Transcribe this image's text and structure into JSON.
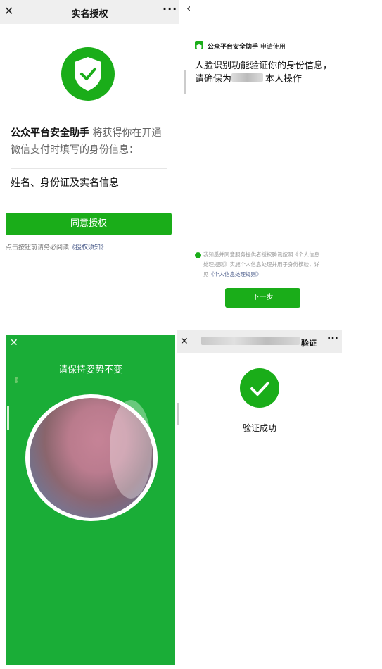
{
  "panel1": {
    "close": "✕",
    "title": "实名授权",
    "more": "···",
    "app_name": "公众平台安全助手",
    "will_get": " 将获得你在开通",
    "will_get_2": "微信支付时填写的身份信息：",
    "info": "姓名、身份证及实名信息",
    "agree_button": "同意授权",
    "notice_prefix": "点击按钮前请务必阅读",
    "notice_link": "《授权须知》"
  },
  "panel2": {
    "back": "‹",
    "app_name": "公众平台安全助手",
    "request": " 申请使用",
    "heading_line1": "人脸识别功能验证你的身份信息，",
    "heading_line2_prefix": "请确保为",
    "heading_line2_suffix": "本人操作",
    "terms_line1": "我知悉并同意服务提供者授权腾讯按照《个人信息",
    "terms_line2": "处理规则》实施个人信息处理并用于身份核验，详",
    "terms_line3_prefix": "见",
    "terms_line3_link": "《个人信息处理规则》",
    "next_button": "下一步"
  },
  "panel3": {
    "close": "✕",
    "hint": "请保持姿势不变"
  },
  "panel4": {
    "close": "✕",
    "title": "验证",
    "more": "···",
    "message": "验证成功"
  },
  "colors": {
    "wechat_green": "#1aad19",
    "capture_green": "#1aad37",
    "link_blue": "#4a5b8a"
  }
}
